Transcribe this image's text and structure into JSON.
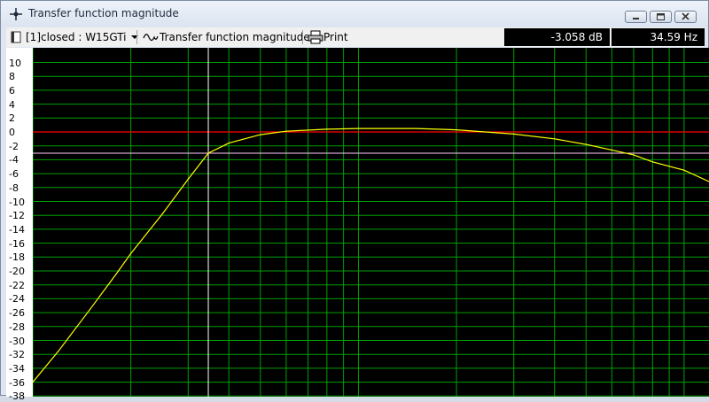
{
  "window": {
    "title": "Transfer function magnitude"
  },
  "toolbar": {
    "measurement": "[1]closed : W15GTi",
    "view": "Transfer function magnitude",
    "print": "Print"
  },
  "readouts": {
    "level": "-3.058 dB",
    "frequency": "34.59 Hz"
  },
  "colors": {
    "curve": "#ffff00",
    "reference_line": "#ff0000",
    "cursor_line": "#ffccff",
    "grid": "#00a000",
    "background": "#000000"
  },
  "chart_data": {
    "type": "line",
    "title": "",
    "xlabel": "",
    "ylabel": "",
    "yticks": [
      "10",
      "8",
      "6",
      "4",
      "2",
      "0",
      "-2",
      "-4",
      "-6",
      "-8",
      "-10",
      "-12",
      "-14",
      "-16",
      "-18",
      "-20",
      "-22",
      "-24",
      "-26",
      "-28",
      "-30",
      "-32",
      "-34",
      "-36",
      "-38"
    ],
    "ylim": [
      -38,
      11
    ],
    "x_scale": "log",
    "reference_level_db": 0,
    "cursor": {
      "frequency_hz": 34.59,
      "level_db": -3.058
    },
    "series": [
      {
        "values": [
          [
            10,
            -36.0
          ],
          [
            12,
            -31.5
          ],
          [
            15,
            -25.5
          ],
          [
            18,
            -20.5
          ],
          [
            20,
            -17.5
          ],
          [
            25,
            -11.8
          ],
          [
            30,
            -6.8
          ],
          [
            34.59,
            -3.058
          ],
          [
            40,
            -1.6
          ],
          [
            50,
            -0.4
          ],
          [
            60,
            0.1
          ],
          [
            80,
            0.4
          ],
          [
            100,
            0.5
          ],
          [
            150,
            0.5
          ],
          [
            200,
            0.3
          ],
          [
            300,
            -0.3
          ],
          [
            400,
            -1.0
          ],
          [
            500,
            -1.8
          ],
          [
            600,
            -2.6
          ],
          [
            700,
            -3.3
          ],
          [
            800,
            -4.3
          ],
          [
            1000,
            -5.5
          ],
          [
            1200,
            -7.2
          ]
        ]
      }
    ]
  }
}
